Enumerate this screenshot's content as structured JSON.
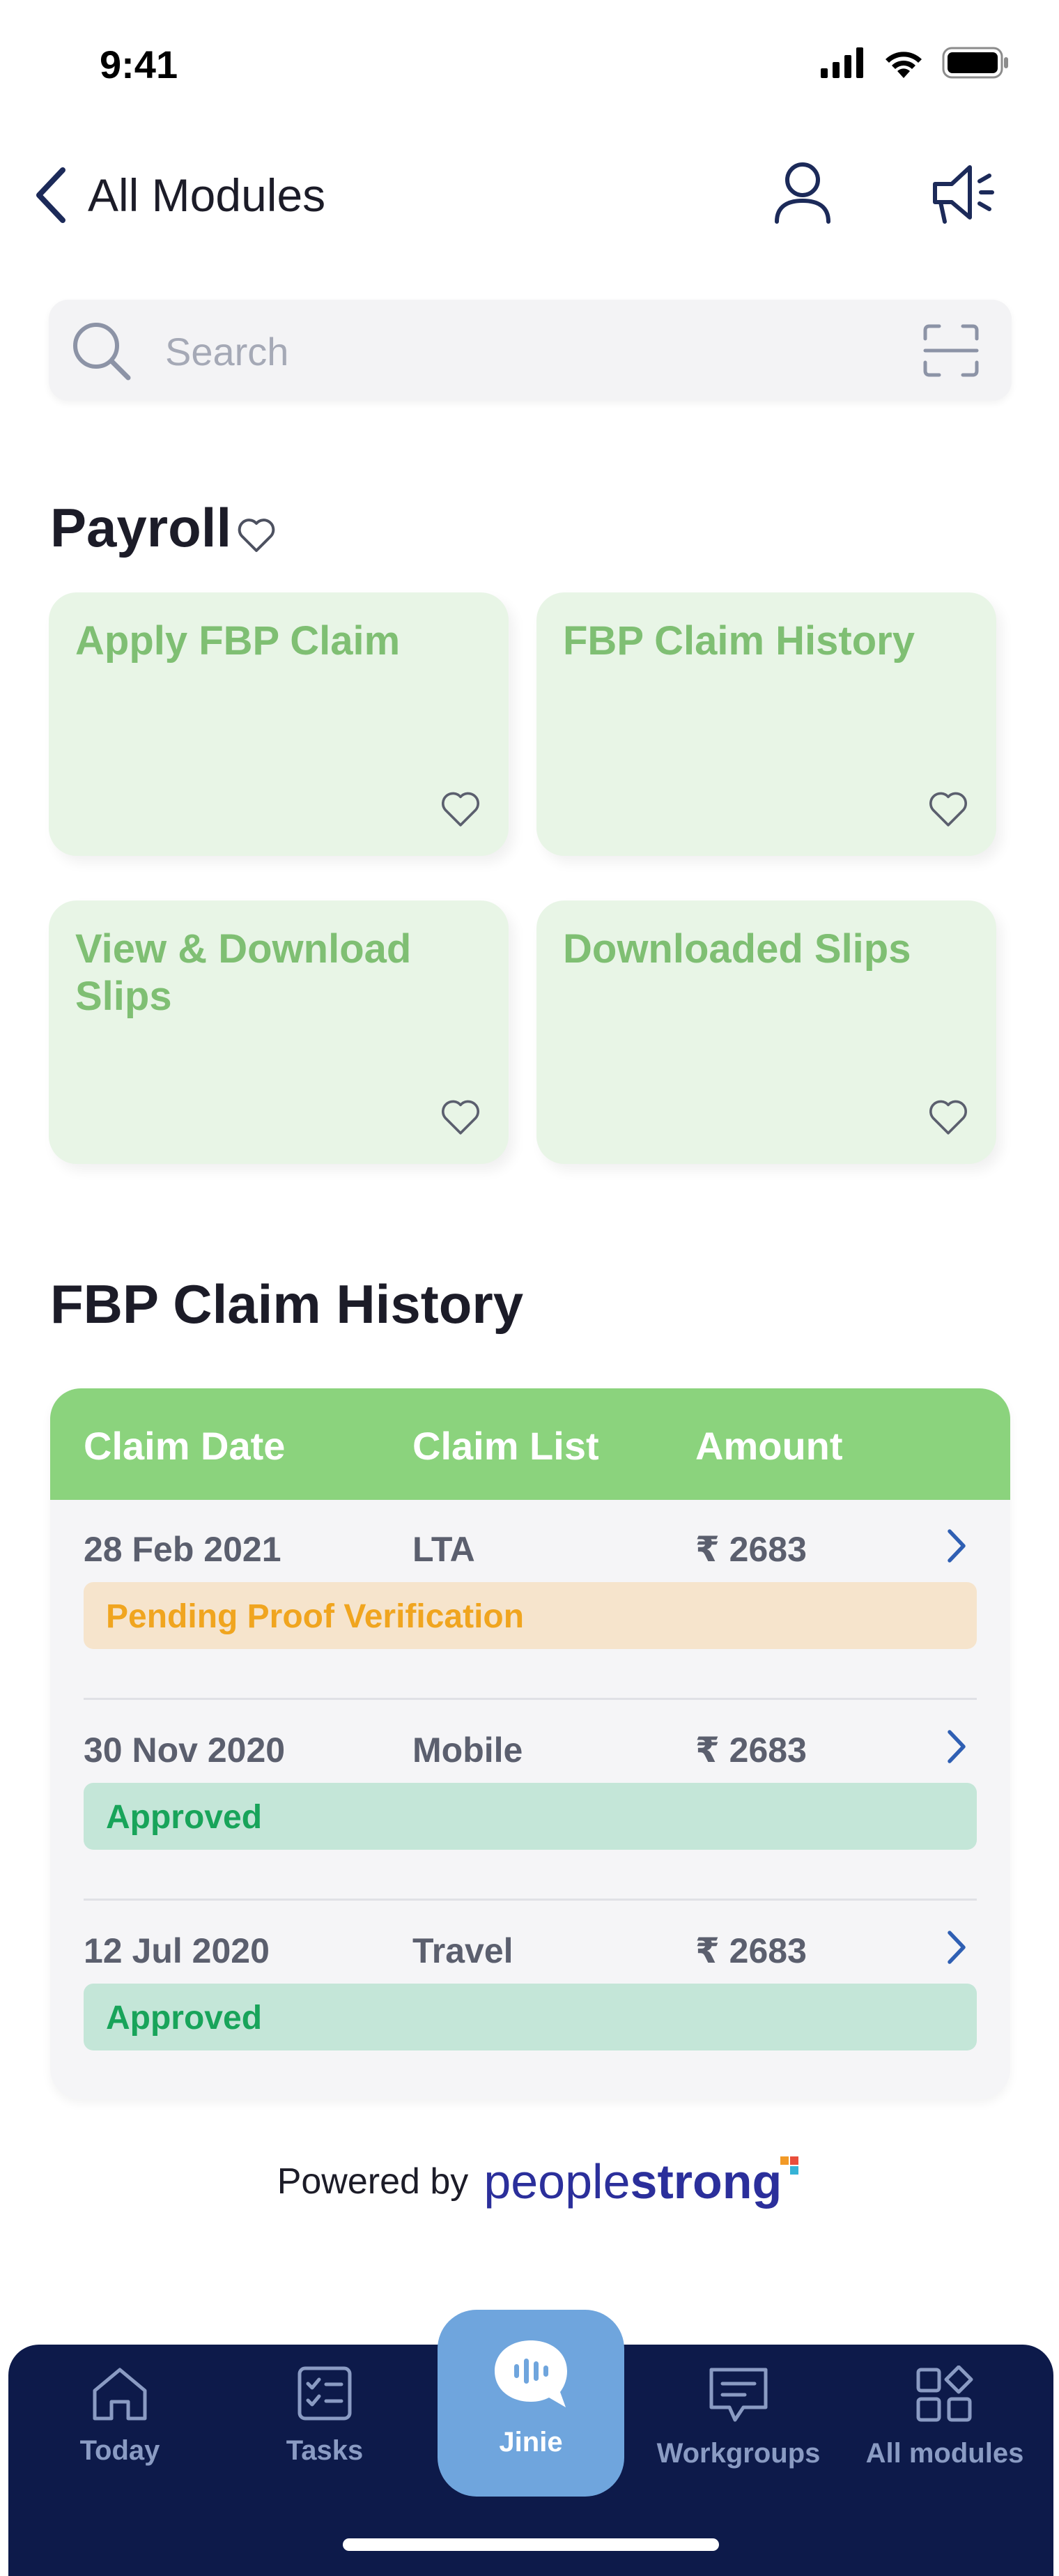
{
  "status_bar": {
    "time": "9:41"
  },
  "header": {
    "back_label": "All Modules",
    "icons": [
      "user-icon",
      "megaphone-icon"
    ]
  },
  "search": {
    "placeholder": "Search"
  },
  "payroll": {
    "title": "Payroll",
    "tiles": [
      {
        "label": "Apply FBP Claim"
      },
      {
        "label": "FBP Claim History"
      },
      {
        "label": "View & Download Slips"
      },
      {
        "label": "Downloaded Slips"
      }
    ]
  },
  "claim_history": {
    "title": "FBP Claim History",
    "columns": [
      "Claim Date",
      "Claim List",
      "Amount"
    ],
    "rows": [
      {
        "date": "28 Feb 2021",
        "item": "LTA",
        "amount": "₹ 2683",
        "status": "Pending Proof Verification",
        "status_type": "pending"
      },
      {
        "date": "30 Nov 2020",
        "item": "Mobile",
        "amount": "₹ 2683",
        "status": "Approved",
        "status_type": "approved"
      },
      {
        "date": "12 Jul 2020",
        "item": "Travel",
        "amount": "₹ 2683",
        "status": "Approved",
        "status_type": "approved"
      }
    ]
  },
  "footer": {
    "powered_by": "Powered by",
    "brand_light": "people",
    "brand_bold": "strong"
  },
  "tabbar": {
    "tabs": [
      {
        "label": "Today",
        "icon": "home-icon"
      },
      {
        "label": "Tasks",
        "icon": "checklist-icon"
      },
      {
        "label": "Jinie",
        "icon": "chat-bubble-icon",
        "active": true
      },
      {
        "label": "Workgroups",
        "icon": "message-icon"
      },
      {
        "label": "All modules",
        "icon": "grid-icon"
      }
    ]
  },
  "colors": {
    "tile_bg": "#e8f5e6",
    "tile_text": "#7fbf73",
    "table_header": "#8bd37d",
    "pending_bg": "#f6e4cc",
    "pending_text": "#f0a51f",
    "approved_bg": "#c4e6d8",
    "approved_text": "#18a45a",
    "tabbar_bg": "#0d1a4a",
    "jinie_bg": "#6fa5dd"
  }
}
